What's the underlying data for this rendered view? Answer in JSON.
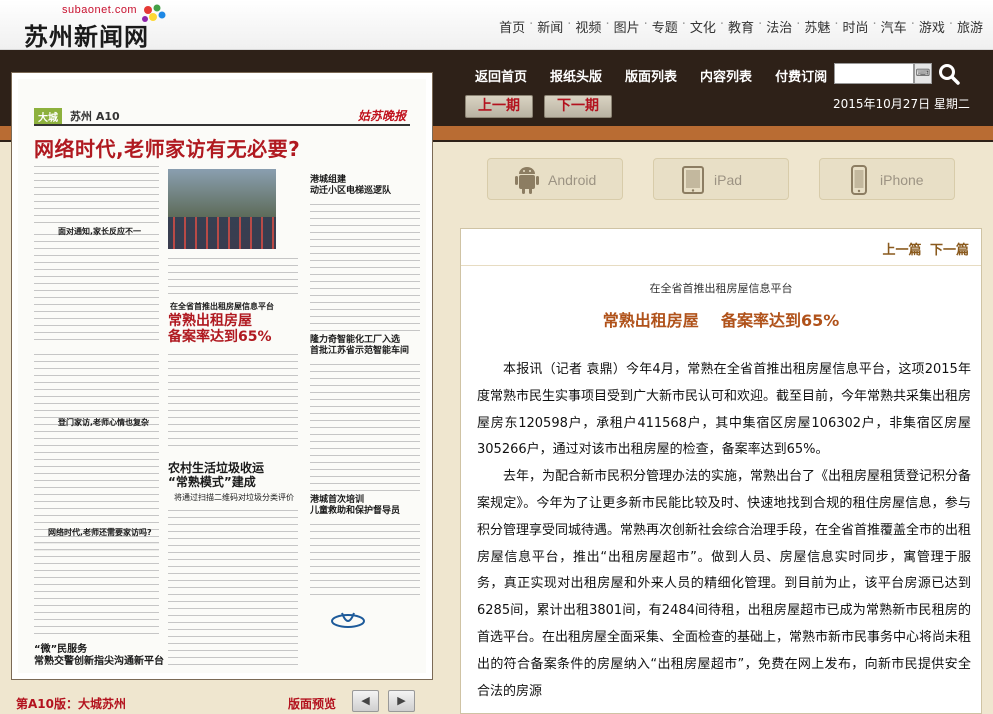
{
  "site": {
    "domain": "subaonet.com",
    "name": "苏州新闻网"
  },
  "nav": [
    "首页",
    "新闻",
    "视频",
    "图片",
    "专题",
    "文化",
    "教育",
    "法治",
    "苏魅",
    "时尚",
    "汽车",
    "游戏",
    "旅游"
  ],
  "toolbar": {
    "items": [
      "返回首页",
      "报纸头版",
      "版面列表",
      "内容列表",
      "付费订阅"
    ],
    "prev_issue": "上一期",
    "next_issue": "下一期",
    "date": "2015年10月27日  星期二"
  },
  "apps": [
    "Android",
    "iPad",
    "iPhone"
  ],
  "page_preview": {
    "section_tag": "大城",
    "section_page": "苏州 A10",
    "masthead": "姑苏晚报",
    "headline": "网络时代,老师家访有无必要?",
    "sub1": "港城组建\n动迁小区电梯巡逻队",
    "sub2_kicker": "在全省首推出租房屋信息平台",
    "sub2": "常熟出租房屋\n备案率达到65%",
    "sub3": "隆力奇智能化工厂入选\n首批江苏省示范智能车间",
    "sub4": "农村生活垃圾收运\n“常熟模式”建成",
    "sub4_deck": "将通过扫描二维码对垃圾分类评价",
    "sub5": "港城首次培训\n儿童救助和保护督导员",
    "sub6": "“微”民服务\n常熟交警创新指尖沟通新平台",
    "side_heads": [
      "面对通知,家长反应不一",
      "登门家访,老师心情也复杂",
      "网络时代,老师还需要家访吗?"
    ]
  },
  "footer": {
    "page_label": "第A10版：大城苏州",
    "preview_label": "版面预览",
    "prev_arrow": "◀",
    "next_arrow": "▶"
  },
  "article": {
    "prev": "上一篇",
    "next": "下一篇",
    "kicker": "在全省首推出租房屋信息平台",
    "headline": "常熟出租房屋    备案率达到65%",
    "paragraphs": [
      "本报讯（记者  袁鼎）今年4月，常熟在全省首推出租房屋信息平台，这项2015年度常熟市民生实事项目受到广大新市民认可和欢迎。截至目前，今年常熟共采集出租房屋房东120598户，承租户411568户，其中集宿区房屋106302户，非集宿区房屋305266户，通过对该市出租房屋的检查，备案率达到65%。",
      "去年，为配合新市民积分管理办法的实施，常熟出台了《出租房屋租赁登记积分备案规定》。今年为了让更多新市民能比较及时、快速地找到合规的租住房屋信息，参与积分管理享受同城待遇。常熟再次创新社会综合治理手段，在全省首推覆盖全市的出租房屋信息平台，推出“出租房屋超市”。做到人员、房屋信息实时同步，寓管理于服务，真正实现对出租房屋和外来人员的精细化管理。到目前为止，该平台房源已达到6285间，累计出租3801间，有2484间待租，出租房屋超市已成为常熟新市民租房的首选平台。在出租房屋全面采集、全面检查的基础上，常熟市新市民事务中心将尚未租出的符合备案条件的房屋纳入“出租房屋超市”，免费在网上发布，向新市民提供安全合法的房源"
    ]
  },
  "colors": {
    "brand_red": "#b3121e",
    "header_brown": "#2e2118",
    "accent_orange": "#b96c33",
    "headline_orange": "#b0521a"
  }
}
